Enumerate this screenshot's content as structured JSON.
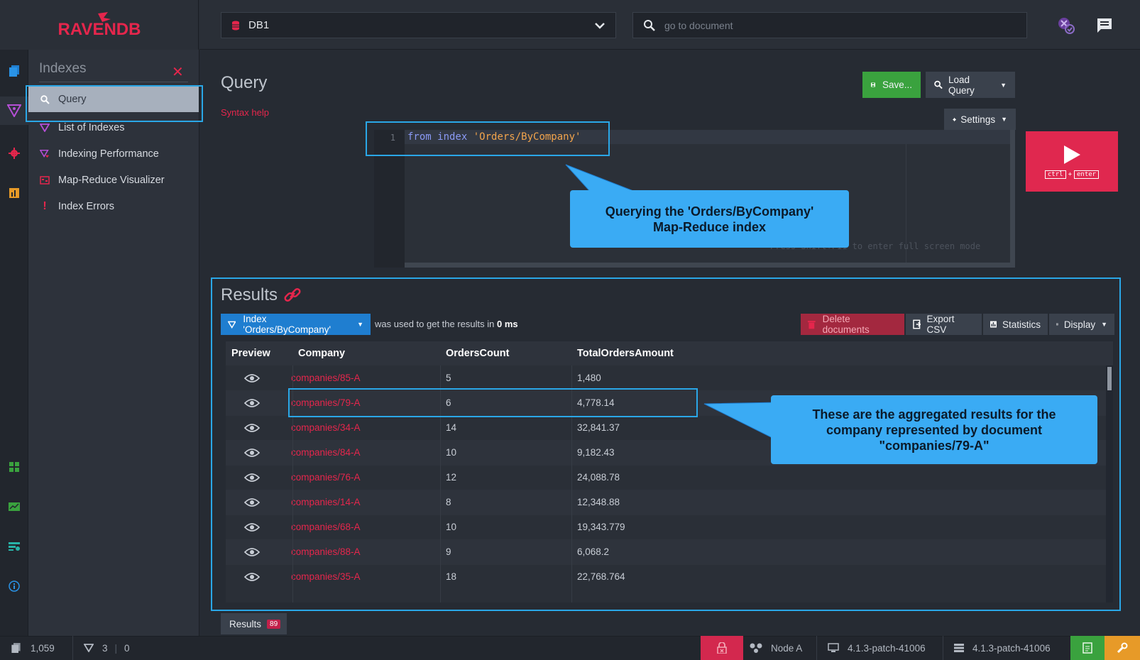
{
  "brand": {
    "logo_text": "RAVENDB"
  },
  "topbar": {
    "database": "DB1",
    "search_placeholder": "go to document"
  },
  "menu": {
    "title": "Indexes",
    "items": [
      {
        "label": "Query",
        "icon": "search-icon"
      },
      {
        "label": "List of Indexes",
        "icon": "index-icon"
      },
      {
        "label": "Indexing Performance",
        "icon": "performance-icon"
      },
      {
        "label": "Map-Reduce Visualizer",
        "icon": "map-reduce-icon"
      },
      {
        "label": "Index Errors",
        "icon": "exclamation-icon"
      }
    ]
  },
  "query": {
    "title": "Query",
    "syntax_help": "Syntax help",
    "save_label": "Save...",
    "load_label": "Load Query",
    "settings_label": "Settings",
    "line_number": "1",
    "code_kw": "from index",
    "code_str": "'Orders/ByCompany'",
    "fullscreen_hint": "Press Shift+F11 to enter full screen mode",
    "run_keys": [
      "ctrl",
      "+",
      "enter"
    ]
  },
  "callouts": {
    "query_line1": "Querying the 'Orders/ByCompany'",
    "query_line2": "Map-Reduce index",
    "result_line1": "These are the aggregated results for the",
    "result_line2": "company represented by document",
    "result_line3": "\"companies/79-A\""
  },
  "results": {
    "title": "Results",
    "index_label": "Index 'Orders/ByCompany'",
    "used_text": "was used to get the results in",
    "duration": "0 ms",
    "delete_label": "Delete documents",
    "export_label": "Export CSV",
    "statistics_label": "Statistics",
    "display_label": "Display",
    "columns": [
      "Preview",
      "Company",
      "OrdersCount",
      "TotalOrdersAmount"
    ],
    "rows": [
      {
        "company": "companies/85-A",
        "orders": "5",
        "total": "1,480"
      },
      {
        "company": "companies/79-A",
        "orders": "6",
        "total": "4,778.14"
      },
      {
        "company": "companies/34-A",
        "orders": "14",
        "total": "32,841.37"
      },
      {
        "company": "companies/84-A",
        "orders": "10",
        "total": "9,182.43"
      },
      {
        "company": "companies/76-A",
        "orders": "12",
        "total": "24,088.78"
      },
      {
        "company": "companies/14-A",
        "orders": "8",
        "total": "12,348.88"
      },
      {
        "company": "companies/68-A",
        "orders": "10",
        "total": "19,343.779"
      },
      {
        "company": "companies/88-A",
        "orders": "9",
        "total": "6,068.2"
      },
      {
        "company": "companies/35-A",
        "orders": "18",
        "total": "22,768.764"
      }
    ],
    "tab_label": "Results",
    "tab_count": "89"
  },
  "status": {
    "documents": "1,059",
    "indexes": "3",
    "errors": "0",
    "node": "Node A",
    "client_version": "4.1.3-patch-41006",
    "server_version": "4.1.3-patch-41006"
  },
  "colors": {
    "accent": "#e5264c",
    "highlight": "#2aa7e7",
    "callout": "#3aabf4",
    "save": "#3aa23e"
  }
}
